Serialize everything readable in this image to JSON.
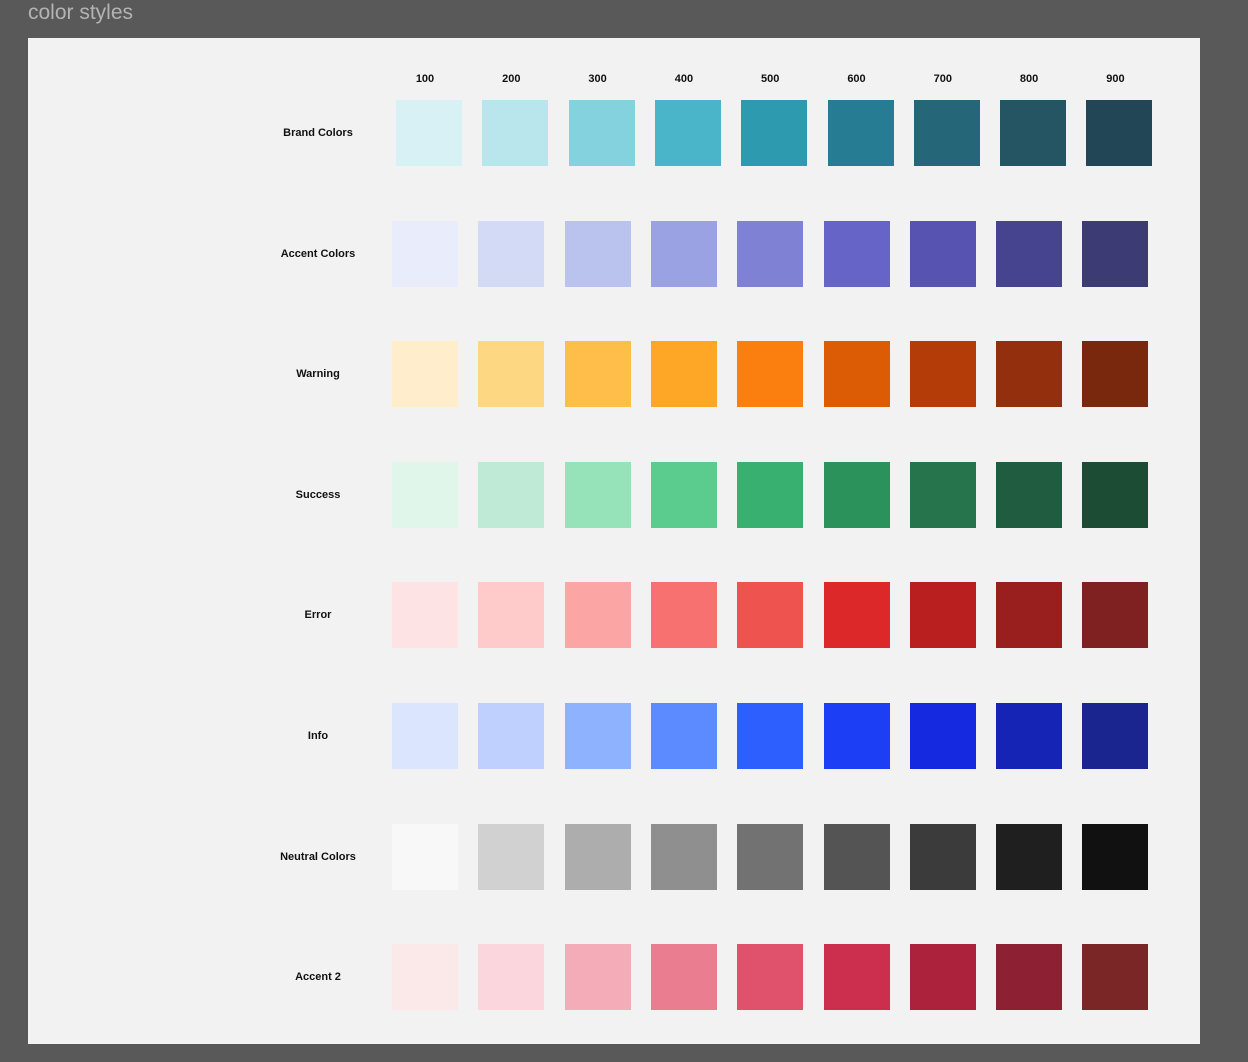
{
  "frame": {
    "title": "color styles"
  },
  "columns": [
    "100",
    "200",
    "300",
    "400",
    "500",
    "600",
    "700",
    "800",
    "900"
  ],
  "rows": [
    {
      "label": "Brand Colors",
      "slug": "brand-colors",
      "colors": [
        "#d8f1f4",
        "#b9e6ec",
        "#84d2dd",
        "#4ab5c8",
        "#2e9ab0",
        "#267d93",
        "#256779",
        "#255463",
        "#234656"
      ]
    },
    {
      "label": "Accent Colors",
      "slug": "accent-colors",
      "colors": [
        "#e9ecfa",
        "#d2daf5",
        "#b9c3ed",
        "#9aa2e3",
        "#7f81d5",
        "#6664c6",
        "#5753b1",
        "#47448f",
        "#3c3b73"
      ]
    },
    {
      "label": "Warning",
      "slug": "warning",
      "colors": [
        "#ffedcc",
        "#fed783",
        "#ffbe4a",
        "#fea626",
        "#fa7f0e",
        "#dc5b05",
        "#b43c08",
        "#932f0d",
        "#79270d"
      ]
    },
    {
      "label": "Success",
      "slug": "success",
      "colors": [
        "#e1f6ea",
        "#bfead5",
        "#96e2b9",
        "#5ccb8e",
        "#38b06f",
        "#2a925a",
        "#25744b",
        "#205d40",
        "#1c4c34"
      ]
    },
    {
      "label": "Error",
      "slug": "error",
      "colors": [
        "#fde3e3",
        "#fecaca",
        "#fca5a5",
        "#f87171",
        "#ef5350",
        "#dc2828",
        "#b91f1f",
        "#991e1e",
        "#7f2121"
      ]
    },
    {
      "label": "Info",
      "slug": "info",
      "colors": [
        "#dbe5fe",
        "#bfcffe",
        "#8fb2fe",
        "#5b8bfe",
        "#2d5efe",
        "#1c3ef5",
        "#152ae0",
        "#1624b5",
        "#1a2590"
      ]
    },
    {
      "label": "Neutral Colors",
      "slug": "neutral-colors",
      "colors": [
        "#f8f8f8",
        "#d1d1d1",
        "#adadad",
        "#8f8f8f",
        "#727272",
        "#545454",
        "#3b3b3b",
        "#1f1f1f",
        "#111111"
      ]
    },
    {
      "label": "Accent 2",
      "slug": "accent-2",
      "colors": [
        "#fbe9e9",
        "#fbd6dd",
        "#f3acb8",
        "#ea7e90",
        "#e0516b",
        "#cc2e4d",
        "#ac213b",
        "#8e2033",
        "#7a2526"
      ]
    }
  ]
}
